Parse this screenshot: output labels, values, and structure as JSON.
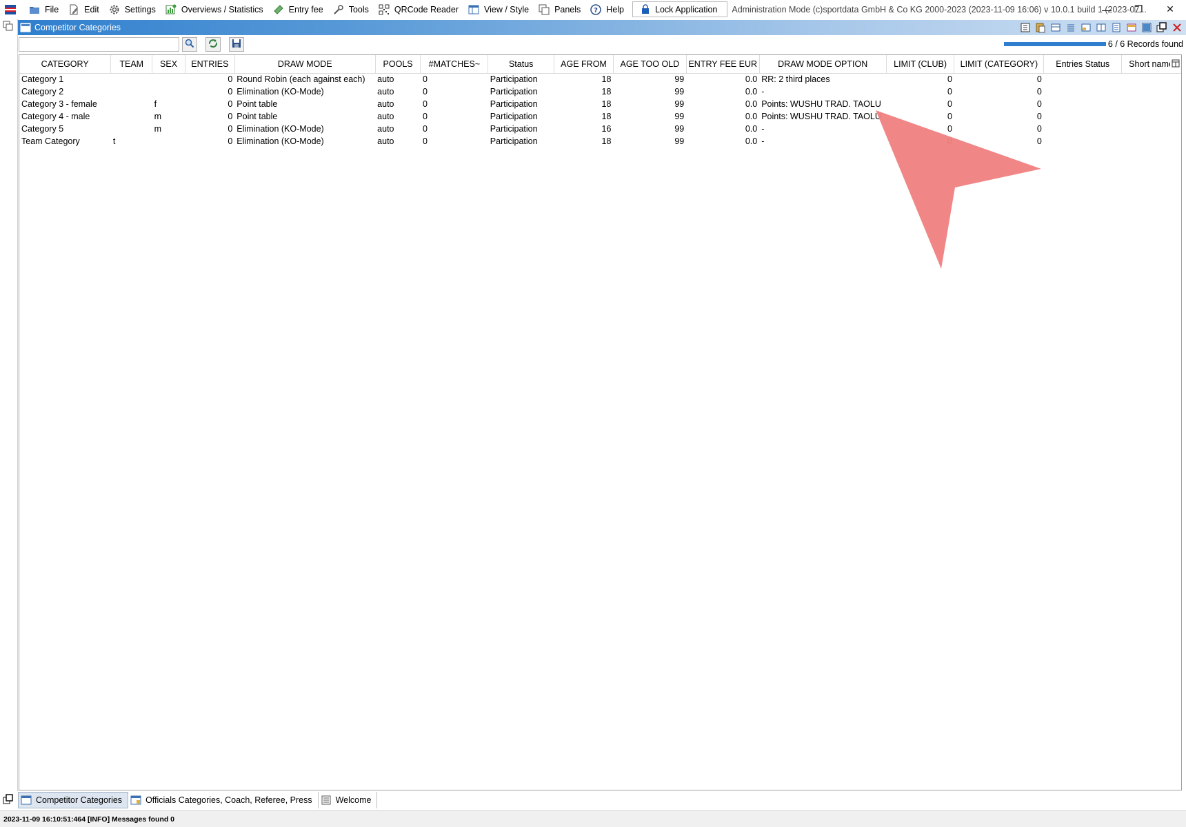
{
  "menubar": {
    "items": [
      {
        "label": "File",
        "icon": "file-icon"
      },
      {
        "label": "Edit",
        "icon": "edit-icon"
      },
      {
        "label": "Settings",
        "icon": "gear-icon"
      },
      {
        "label": "Overviews / Statistics",
        "icon": "statistics-icon"
      },
      {
        "label": "Entry fee",
        "icon": "money-icon"
      },
      {
        "label": "Tools",
        "icon": "wrench-icon"
      },
      {
        "label": "QRCode Reader",
        "icon": "qrcode-icon"
      },
      {
        "label": "View / Style",
        "icon": "view-icon"
      },
      {
        "label": "Panels",
        "icon": "panels-icon"
      },
      {
        "label": "Help",
        "icon": "help-icon"
      }
    ],
    "lock_label": "Lock Application",
    "admin_text": "Administration Mode (c)sportdata GmbH & Co KG 2000-2023 (2023-11-09 16:06)  v 10.0.1 build 1 (2023-07..."
  },
  "window_controls": {
    "minimize": "—",
    "restore": "❐",
    "close": "✕"
  },
  "panel": {
    "title": "Competitor Categories"
  },
  "toolbar": {
    "search_value": "",
    "search_placeholder": "",
    "progress_fraction": 1.0,
    "records_found": "6 / 6 Records found"
  },
  "table": {
    "columns": [
      "CATEGORY",
      "TEAM",
      "SEX",
      "ENTRIES",
      "DRAW MODE",
      "POOLS",
      "#MATCHES~",
      "Status",
      "AGE FROM",
      "AGE TOO OLD",
      "ENTRY FEE EUR",
      "DRAW MODE OPTION",
      "LIMIT (CLUB)",
      "LIMIT (CATEGORY)",
      "Entries Status",
      "Short name"
    ],
    "rows": [
      [
        "Category 1",
        "",
        "",
        "0",
        "Round Robin (each against each)",
        "auto",
        "0",
        "Participation",
        "18",
        "99",
        "0.0",
        "RR: 2 third places",
        "0",
        "0",
        "",
        ""
      ],
      [
        "Category 2",
        "",
        "",
        "0",
        "Elimination (KO-Mode)",
        "auto",
        "0",
        "Participation",
        "18",
        "99",
        "0.0",
        "-",
        "0",
        "0",
        "",
        ""
      ],
      [
        "Category 3 - female",
        "",
        "f",
        "0",
        "Point table",
        "auto",
        "0",
        "Participation",
        "18",
        "99",
        "0.0",
        "Points: WUSHU TRAD. TAOLU",
        "0",
        "0",
        "",
        ""
      ],
      [
        "Category 4 - male",
        "",
        "m",
        "0",
        "Point table",
        "auto",
        "0",
        "Participation",
        "18",
        "99",
        "0.0",
        "Points: WUSHU TRAD. TAOLU",
        "0",
        "0",
        "",
        ""
      ],
      [
        "Category 5",
        "",
        "m",
        "0",
        "Elimination (KO-Mode)",
        "auto",
        "0",
        "Participation",
        "16",
        "99",
        "0.0",
        "-",
        "0",
        "0",
        "",
        ""
      ],
      [
        "Team Category",
        "t",
        "",
        "0",
        "Elimination (KO-Mode)",
        "auto",
        "0",
        "Participation",
        "18",
        "99",
        "0.0",
        "-",
        "0",
        "0",
        "",
        ""
      ]
    ]
  },
  "bottom_tabs": [
    {
      "label": "Competitor Categories",
      "active": true
    },
    {
      "label": "Officials Categories, Coach, Referee, Press",
      "active": false
    },
    {
      "label": "Welcome",
      "active": false
    }
  ],
  "status": {
    "message": "2023-11-09 16:10:51:464 [INFO] Messages found 0"
  },
  "colors": {
    "title_bar": "#2f7fce",
    "cursor_overlay": "#f08080"
  }
}
